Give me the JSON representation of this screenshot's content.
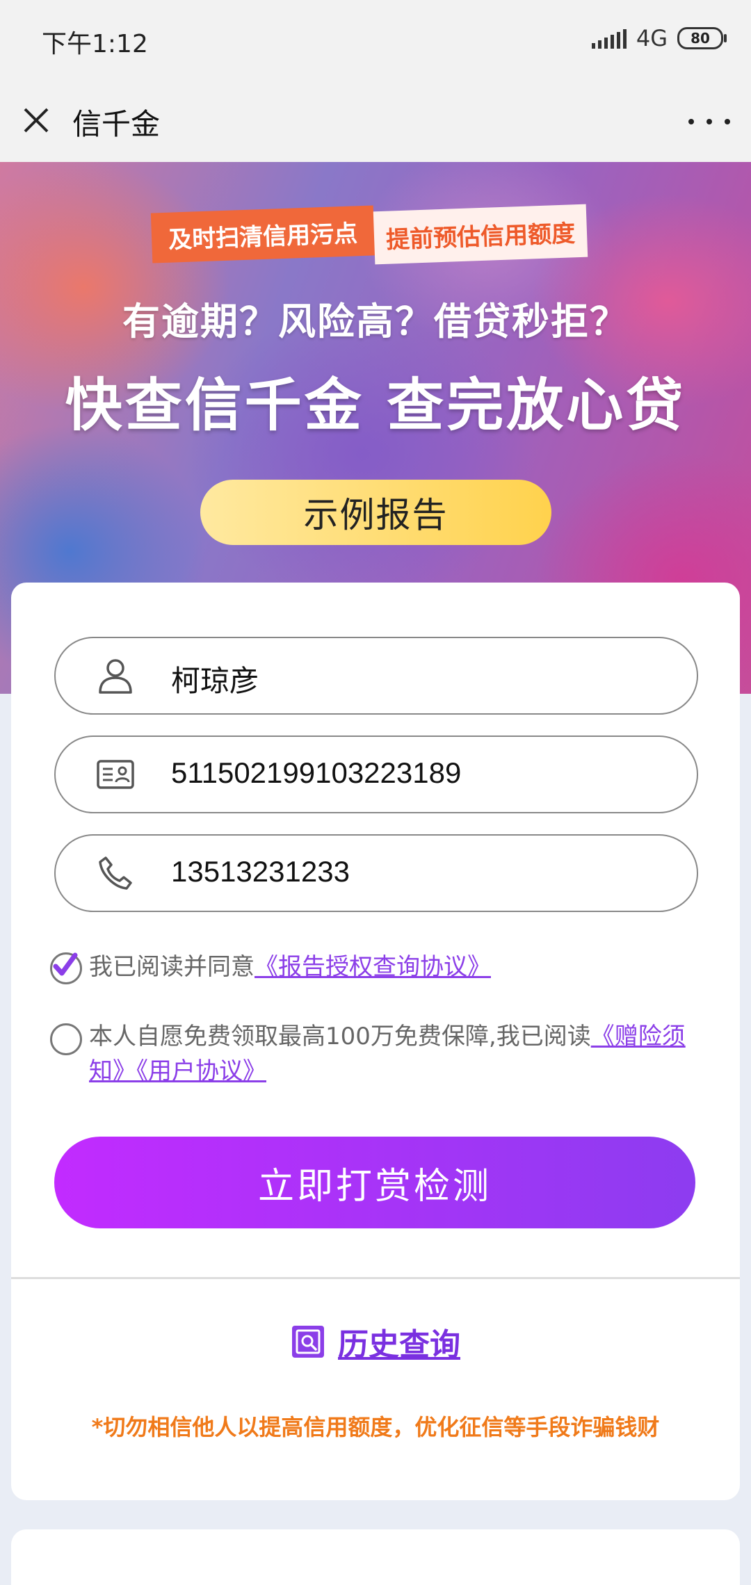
{
  "status_bar": {
    "time": "下午1:12",
    "network": "4G",
    "battery": "80"
  },
  "nav": {
    "title": "信千金"
  },
  "banner": {
    "tag_left": "及时扫清信用污点",
    "tag_right": "提前预估信用额度",
    "headline": "有逾期？风险高？借贷秒拒？",
    "slogan": "快查信千金 查完放心贷",
    "sample_button": "示例报告"
  },
  "form": {
    "name": "柯琼彦",
    "id_number": "511502199103223189",
    "phone": "13513231233"
  },
  "agreements": {
    "agree1_text": "我已阅读并同意",
    "agree1_link": "《报告授权查询协议》",
    "agree2_text": "本人自愿免费领取最高100万免费保障,我已阅读",
    "agree2_link": "《赠险须知》《用户协议》"
  },
  "actions": {
    "submit": "立即打赏检测",
    "history": "历史查询"
  },
  "warning": "*切勿相信他人以提高信用额度，优化征信等手段诈骗钱财",
  "colors": {
    "accent": "#8b3ee8",
    "submit_start": "#c22bff",
    "submit_end": "#8d3cf0",
    "warning": "#f07a1a",
    "sample_btn": "#ffd24d"
  }
}
